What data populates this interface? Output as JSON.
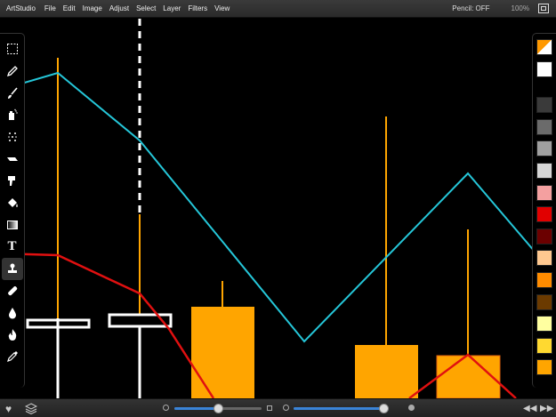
{
  "menubar": {
    "app_name": "ArtStudio",
    "menus": [
      "File",
      "Edit",
      "Image",
      "Adjust",
      "Select",
      "Layer",
      "Filters",
      "View"
    ],
    "status": "Pencil: OFF",
    "zoom": "100%"
  },
  "toolbar": {
    "tools": [
      "selection-tool",
      "pencil-tool",
      "brush-tool",
      "spray-tool",
      "scatter-tool",
      "eraser-tool",
      "smudge-tool",
      "fill-tool",
      "gradient-tool",
      "text-tool",
      "stamp-tool",
      "bandage-tool",
      "blur-tool",
      "burn-tool",
      "eyedropper-tool"
    ],
    "text_tool_glyph": "T",
    "active_tool": "stamp-tool"
  },
  "palette": {
    "primary_colors": [
      "#ff9900",
      "#ffffff"
    ],
    "swatches": [
      "#3a3a3a",
      "#6b6b6b",
      "#a0a0a0",
      "#d6d6d6",
      "#f4a0a0",
      "#e10000",
      "#6b0000",
      "#ffc890",
      "#ff8c00",
      "#6b3a00",
      "#ffffa0",
      "#ffd930",
      "#ffa500"
    ]
  },
  "colors": {
    "accent_orange": "#ffa500",
    "line_cyan": "#25c6d8",
    "line_red": "#e01010",
    "outline_white": "#ffffff",
    "slider_blue": "#3a84d8"
  },
  "bottombar": {
    "icons": [
      "heart-icon",
      "layers-icon",
      "rewind-icon",
      "forward-icon"
    ],
    "size_slider_value": 0.51,
    "opacity_slider_value": 1.0
  }
}
